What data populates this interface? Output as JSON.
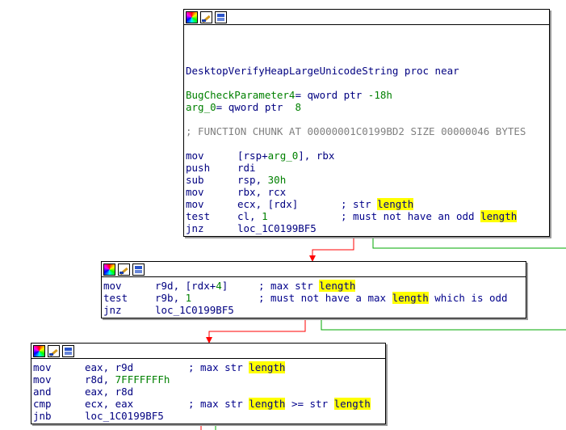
{
  "block1": {
    "proc": "DesktopVerifyHeapLargeUnicodeString proc near",
    "var1_name": "BugCheckParameter4",
    "var1_decl": "= qword ptr",
    "var1_off": "-18h",
    "var2_name": "arg_0",
    "var2_decl": "= qword ptr",
    "var2_off": "8",
    "chunk_comment": "; FUNCTION CHUNK AT 00000001C0199BD2 SIZE 00000046 BYTES",
    "i1_mn": "mov",
    "i1_a": "[rsp+",
    "i1_b": "arg_0",
    "i1_c": "], rbx",
    "i2_mn": "push",
    "i2_op": "rdi",
    "i3_mn": "sub",
    "i3_a": "rsp, ",
    "i3_num": "30h",
    "i4_mn": "mov",
    "i4_op": "rbx, rcx",
    "i5_mn": "mov",
    "i5_op": "ecx, [rdx]",
    "i5_cmt": "; str ",
    "i5_hl": "length",
    "i6_mn": "test",
    "i6_a": "cl, ",
    "i6_num": "1",
    "i6_cmt": "; must not have an odd ",
    "i6_hl": "length",
    "i7_mn": "jnz",
    "i7_op": "loc_1C0199BF5"
  },
  "block2": {
    "i1_mn": "mov",
    "i1_a": "r9d, [rdx+",
    "i1_num": "4",
    "i1_b": "]",
    "i1_cmt": "; max str ",
    "i1_hl": "length",
    "i2_mn": "test",
    "i2_a": "r9b, ",
    "i2_num": "1",
    "i2_cmt": "; must not have a max ",
    "i2_hl": "length",
    "i2_tail": " which is odd",
    "i3_mn": "jnz",
    "i3_op": "loc_1C0199BF5"
  },
  "block3": {
    "i1_mn": "mov",
    "i1_op": "eax, r9d",
    "i1_cmt": "; max str ",
    "i1_hl": "length",
    "i2_mn": "mov",
    "i2_a": "r8d, ",
    "i2_num": "7FFFFFFFh",
    "i3_mn": "and",
    "i3_op": "eax, r8d",
    "i4_mn": "cmp",
    "i4_op": "ecx, eax",
    "i4_cmt": "; max str ",
    "i4_hl": "length",
    "i4_mid": " >= str ",
    "i4_hl2": "length",
    "i5_mn": "jnb",
    "i5_op": "loc_1C0199BF5"
  },
  "colors": {
    "true_edge": "#00aa00",
    "false_edge": "#ff0000",
    "highlight": "#ffff00",
    "instruction": "#000080",
    "name": "#008000"
  }
}
